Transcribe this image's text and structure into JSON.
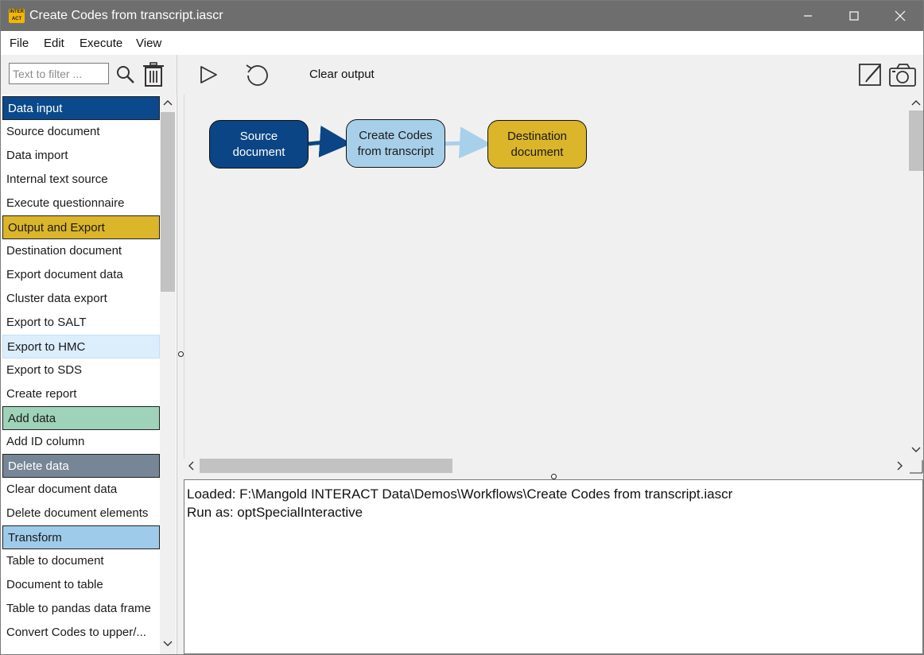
{
  "window": {
    "title": "Create Codes from transcript.iascr",
    "icon_text": "INTER ACT"
  },
  "menu": [
    "File",
    "Edit",
    "Execute",
    "View"
  ],
  "left_toolbar": {
    "filter_placeholder": "Text to filter ..."
  },
  "toolbar": {
    "clear_output_label": "Clear output"
  },
  "list_items": [
    {
      "label": "Data input",
      "type": "header",
      "color": "#0a4a8c",
      "text_color": "#ffffff"
    },
    {
      "label": "Source document"
    },
    {
      "label": "Data import"
    },
    {
      "label": "Internal text source"
    },
    {
      "label": "Execute questionnaire"
    },
    {
      "label": "Output and Export",
      "type": "header",
      "color": "#dbb52a",
      "text_color": "#1a1a1a"
    },
    {
      "label": "Destination document"
    },
    {
      "label": "Export document data"
    },
    {
      "label": "Cluster data export"
    },
    {
      "label": "Export to SALT"
    },
    {
      "label": "Export to HMC",
      "type": "hover"
    },
    {
      "label": "Export to SDS"
    },
    {
      "label": "Create report"
    },
    {
      "label": "Add data",
      "type": "header",
      "color": "#9fd3b9",
      "text_color": "#1a1a1a"
    },
    {
      "label": "Add ID column"
    },
    {
      "label": "Delete data",
      "type": "header",
      "color": "#768696",
      "text_color": "#ffffff"
    },
    {
      "label": "Clear document data"
    },
    {
      "label": "Delete document elements"
    },
    {
      "label": "Transform",
      "type": "header",
      "color": "#9fcbea",
      "text_color": "#1a1a1a"
    },
    {
      "label": "Table to document"
    },
    {
      "label": "Document to table"
    },
    {
      "label": "Table to pandas data frame"
    },
    {
      "label": "Convert Codes to upper/..."
    }
  ],
  "workflow": {
    "nodes": [
      {
        "id": "source",
        "label_line1": "Source",
        "label_line2": "document",
        "color": "#0b4585",
        "text_color": "#ffffff"
      },
      {
        "id": "create",
        "label_line1": "Create Codes",
        "label_line2": "from transcript",
        "color": "#a8cfe9",
        "text_color": "#1a1a1a"
      },
      {
        "id": "dest",
        "label_line1": "Destination",
        "label_line2": "document",
        "color": "#dbb52a",
        "text_color": "#1a1a1a"
      }
    ],
    "edge_colors": [
      "#0b4585",
      "#a8d0ea"
    ]
  },
  "output": {
    "lines": [
      "Loaded: F:\\Mangold INTERACT Data\\Demos\\Workflows\\Create Codes from transcript.iascr",
      "Run as: optSpecialInteractive"
    ]
  }
}
